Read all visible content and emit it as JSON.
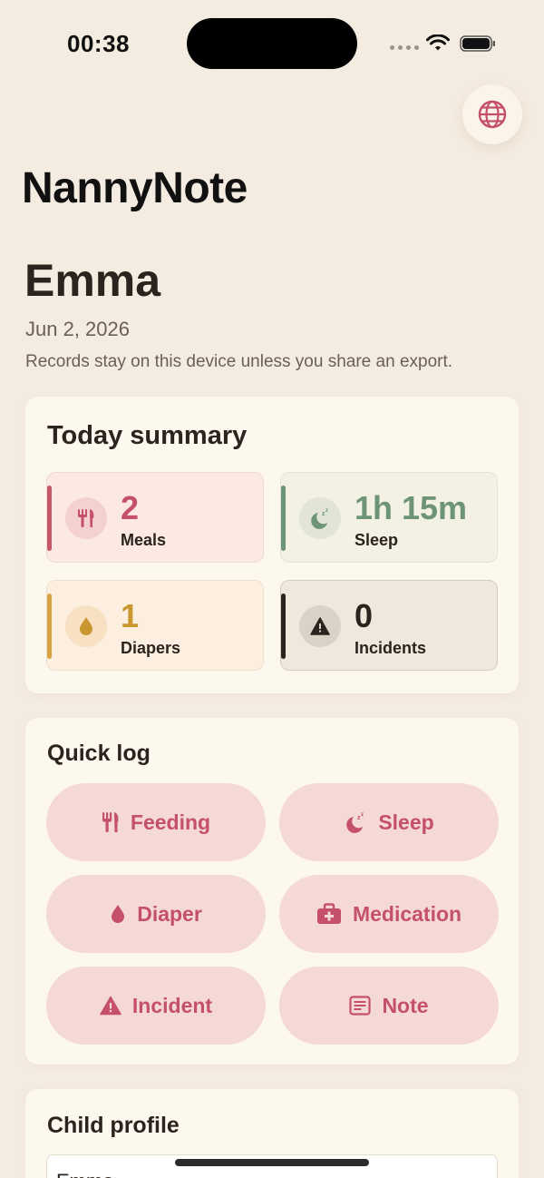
{
  "status_bar": {
    "time": "00:38"
  },
  "app": {
    "title": "NannyNote"
  },
  "child": {
    "name": "Emma",
    "date": "Jun 2, 2026",
    "privacy_note": "Records stay on this device unless you share an export."
  },
  "summary": {
    "title": "Today summary",
    "stats": [
      {
        "value": "2",
        "label": "Meals",
        "icon": "fork-knife-icon",
        "color": "#c45069"
      },
      {
        "value": "1h 15m",
        "label": "Sleep",
        "icon": "moon-zzz-icon",
        "color": "#6c9475"
      },
      {
        "value": "1",
        "label": "Diapers",
        "icon": "drop-icon",
        "color": "#c9962f"
      },
      {
        "value": "0",
        "label": "Incidents",
        "icon": "warning-icon",
        "color": "#2b231d"
      }
    ]
  },
  "quick_log": {
    "title": "Quick log",
    "buttons": [
      {
        "label": "Feeding",
        "icon": "fork-knife-icon"
      },
      {
        "label": "Sleep",
        "icon": "moon-zzz-icon"
      },
      {
        "label": "Diaper",
        "icon": "drop-icon"
      },
      {
        "label": "Medication",
        "icon": "medical-kit-icon"
      },
      {
        "label": "Incident",
        "icon": "warning-icon"
      },
      {
        "label": "Note",
        "icon": "note-icon"
      }
    ]
  },
  "profile": {
    "title": "Child profile",
    "name_value": "Emma"
  },
  "colors": {
    "accent": "#c45069",
    "background": "#f5ece1",
    "card": "#fdf8ee"
  }
}
